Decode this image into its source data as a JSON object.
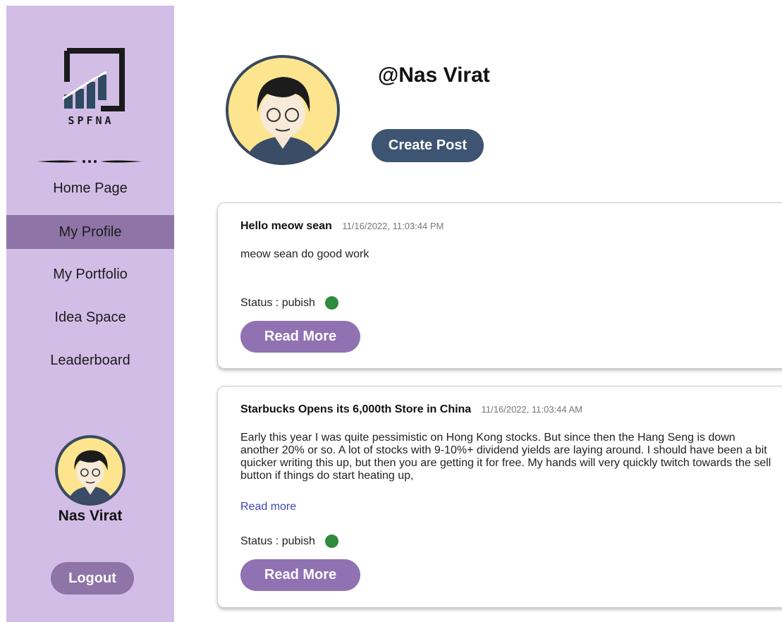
{
  "app": {
    "logo_text": "SPFNA"
  },
  "sidebar": {
    "items": [
      {
        "label": "Home Page",
        "active": false
      },
      {
        "label": "My Profile",
        "active": true
      },
      {
        "label": "My Portfolio",
        "active": false
      },
      {
        "label": "Idea Space",
        "active": false
      },
      {
        "label": "Leaderboard",
        "active": false
      }
    ],
    "user_name": "Nas Virat",
    "logout_label": "Logout"
  },
  "profile": {
    "handle": "@Nas Virat",
    "create_post_label": "Create Post"
  },
  "posts": [
    {
      "title": "Hello meow sean",
      "date": "11/16/2022, 11:03:44 PM",
      "body": "meow sean do good work",
      "status_label": "Status : pubish",
      "status_color": "#2e8b3a",
      "read_more_button": "Read More"
    },
    {
      "title": "Starbucks Opens its 6,000th Store in China",
      "date": "11/16/2022, 11:03:44 AM",
      "body": "Early this year I was quite pessimistic on Hong Kong stocks. But since then the Hang Seng is down another 20% or so. A lot of stocks with 9-10%+ dividend yields are laying around. I should have been a bit quicker writing this up, but then you are getting it for free. My hands will very quickly twitch towards the sell button if things do start heating up,",
      "read_more_link": "Read more",
      "status_label": "Status : pubish",
      "status_color": "#2e8b3a",
      "read_more_button": "Read More"
    }
  ],
  "colors": {
    "sidebar_bg": "#d2bde6",
    "sidebar_active": "#8f74a7",
    "create_post_bg": "#3d5572",
    "read_more_bg": "#9072b3",
    "link": "#3d46b3"
  }
}
